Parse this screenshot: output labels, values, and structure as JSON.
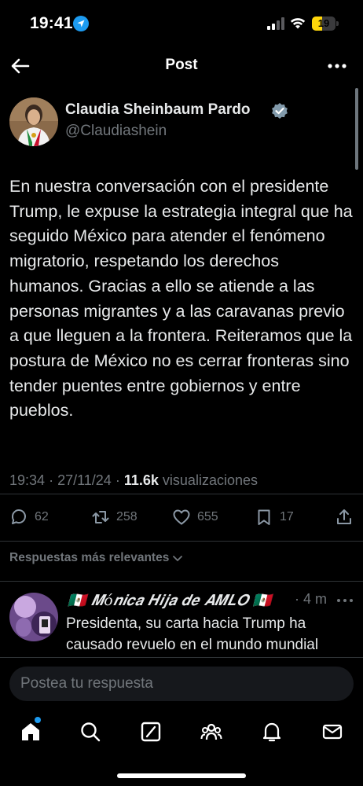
{
  "status_bar": {
    "time": "19:41",
    "battery_level": "19",
    "battery_fraction": 0.19,
    "icons": [
      "location-arrow-icon",
      "cellular-signal-icon",
      "wifi-icon",
      "battery-icon"
    ]
  },
  "header": {
    "title": "Post",
    "back_icon": "arrow-left-icon",
    "more_icon": "more-horizontal-icon"
  },
  "tweet": {
    "author_name": "Claudia Sheinbaum Pardo",
    "author_handle": "@Claudiashein",
    "verified": true,
    "text": "En nuestra conversación con el presidente Trump, le expuse la estrategia integral que ha seguido México para atender el fenómeno migratorio, respetando los derechos humanos. Gracias a ello se atiende a las personas migrantes y a las caravanas previo a que lleguen a la frontera. Reiteramos que la postura de México no es cerrar fronteras sino tender puentes entre gobiernos y entre pueblos.",
    "time": "19:34",
    "date": "27/11/24",
    "separator": "·",
    "views_count": "11.6k",
    "views_label": "visualizaciones"
  },
  "actions": {
    "replies": "62",
    "retweets": "258",
    "likes": "655",
    "bookmarks": "17"
  },
  "replies_filter": {
    "label": "Respuestas más relevantes"
  },
  "reply": {
    "name": "🇲🇽 𝑴ó𝒏𝒊𝒄𝒂 𝑯𝒊𝒋𝒂 𝒅𝒆 𝑨𝑴𝑳𝑶 🇲🇽",
    "time": "· 4 m",
    "text": "Presidenta, su carta hacia Trump ha causado revuelo en el mundo mundial"
  },
  "composer": {
    "placeholder": "Postea tu respuesta"
  },
  "tabbar": {
    "items": [
      "home-icon",
      "search-icon",
      "grok-icon",
      "communities-icon",
      "notifications-icon",
      "messages-icon"
    ]
  },
  "colors": {
    "background": "#000000",
    "text": "#e7e9ea",
    "muted": "#71767b",
    "accent": "#1d9bf0",
    "battery": "#ffd60a",
    "divider": "#2f3336"
  }
}
